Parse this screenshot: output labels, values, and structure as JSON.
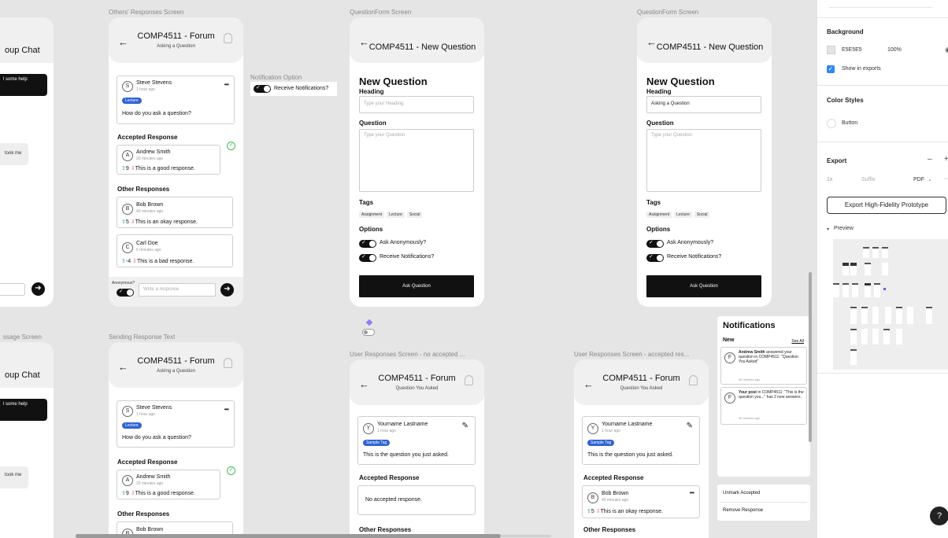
{
  "frame_labels": {
    "others_responses": "Others' Responses Screen",
    "question_form_1": "QuestionForm Screen",
    "question_form_2": "QuestionForm Screen",
    "notification_option": "Notification Option",
    "sending_response": "Sending Response Text",
    "user_no_accepted": "User Responses Screen - no accepted ...",
    "user_accepted": "User Responses Screen - accepted res...",
    "message_screen": "ssage Screen"
  },
  "left_partial": {
    "group_chat": "oup Chat",
    "need_help": "l some help",
    "took_me": "took me",
    "group_chat_2": "oup Chat",
    "need_help_2": "l some help",
    "took_me_2": "took me"
  },
  "forum": {
    "title": "COMP4511 - Forum",
    "subtitle_asking": "Asking a Question",
    "subtitle_you_asked": "Question You Asked",
    "new_question_title": "COMP4511 - New Question"
  },
  "question_post": {
    "author": "Steve Stevens",
    "time": "1 hour ago",
    "tag": "Lecture",
    "text": "How do you ask a question?",
    "menu": "•••"
  },
  "sections": {
    "accepted": "Accepted Response",
    "other": "Other Responses"
  },
  "responses": [
    {
      "initial": "A",
      "name": "Andrew Smith",
      "time": "20 minutes ago",
      "votes": "9",
      "text": "This is a good response."
    },
    {
      "initial": "B",
      "name": "Bob Brown",
      "time": "40 minutes ago",
      "votes": "5",
      "text": "This is an okay response."
    },
    {
      "initial": "C",
      "name": "Carl Doe",
      "time": "5 minutes ago",
      "votes": "-4",
      "text": "This is a bad response."
    }
  ],
  "composer": {
    "anonymous_label": "Anonymous?",
    "placeholder": "Write a response"
  },
  "notification_option": {
    "label": "Receive Notifications?"
  },
  "new_question_form": {
    "heading_title": "New Question",
    "heading_label": "Heading",
    "heading_placeholder": "Type your Heading",
    "heading_value": "Asking a Question",
    "question_label": "Question",
    "question_placeholder": "Type your Question",
    "tags_label": "Tags",
    "tags": [
      "Assignment",
      "Lecture",
      "Social"
    ],
    "options_label": "Options",
    "opt_anonymous": "Ask Anonymously?",
    "opt_notifications": "Receive Notifications?",
    "submit": "Ask Question"
  },
  "user_post": {
    "initial": "Y",
    "author": "Yourname Lastname",
    "time": "1 hour ago",
    "tag": "Sample Tag",
    "text": "This is the question you just asked.",
    "no_accepted": "No accepted response."
  },
  "notifications": {
    "title": "Notifications",
    "new_label": "New",
    "see_all": "See All",
    "items": [
      {
        "initial": "F",
        "bold": "Andrew Smith",
        "rest": "answered your question in COMP4511: \"Question You Asked\"",
        "time": "30 minutes ago"
      },
      {
        "initial": "F",
        "bold": "Your post",
        "rest": "in COMP4511: \"This is the question you...\" has 2 new answers.",
        "time": "30 minutes ago"
      }
    ]
  },
  "context_menu": {
    "unmark": "Unmark Accepted",
    "remove": "Remove Response"
  },
  "right_panel": {
    "background_title": "Background",
    "bg_hex": "E5E5E5",
    "bg_opacity": "100%",
    "show_in_exports": "Show in exports",
    "color_styles_title": "Color Styles",
    "color_style_name": "Button",
    "export_title": "Export",
    "export_scale": "1x",
    "export_suffix": "Suffix",
    "export_format": "PDF",
    "export_button": "Export High-Fidelity Prototype",
    "preview_label": "Preview",
    "help": "?"
  },
  "colors": {
    "canvas": "#e5e5e5",
    "tag_blue": "#2f63d6",
    "upvote": "#2ea043",
    "downvote": "#e5534b",
    "accepted_check": "#3fbf55"
  }
}
